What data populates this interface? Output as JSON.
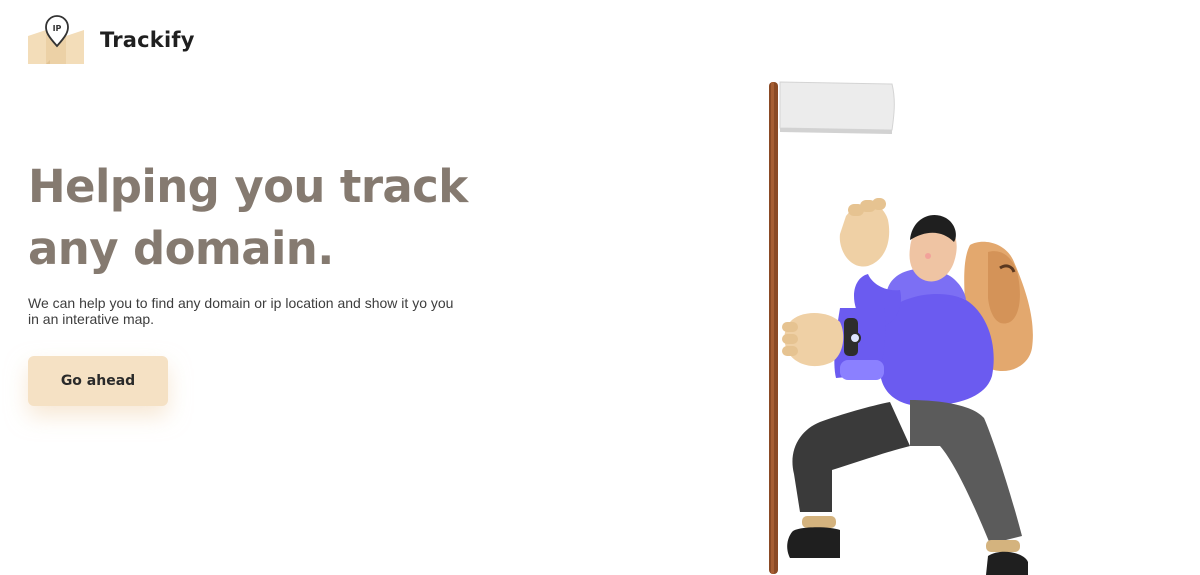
{
  "brand": {
    "name": "Trackify",
    "logo_text": "IP",
    "logo_icon": "map-pin-icon"
  },
  "hero": {
    "title": "Helping you track any domain.",
    "description": "We can help you to find any domain or ip location and show it yo you in an interative map.",
    "cta_label": "Go ahead"
  },
  "colors": {
    "accent": "#f5e1c4",
    "title": "#857a70",
    "text": "#3d3d3d",
    "brand_text": "#1f1f1f"
  },
  "illustration": {
    "icon": "hiker-with-flag-icon"
  }
}
